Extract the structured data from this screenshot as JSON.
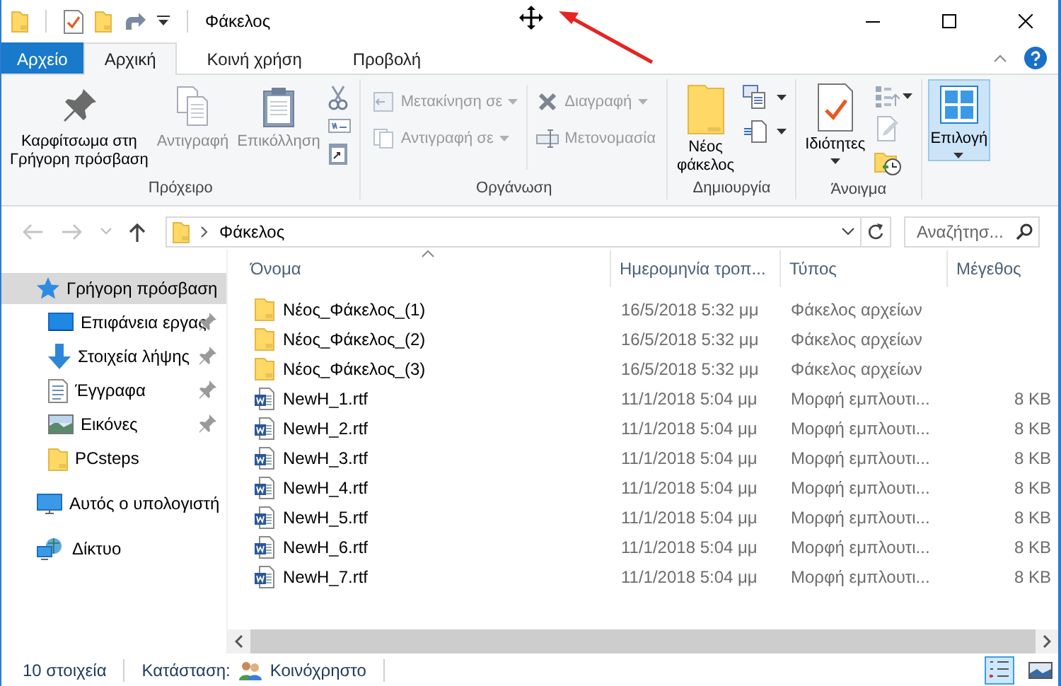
{
  "title_bar": {
    "title": "Φάκελος"
  },
  "ribbon": {
    "tabs": [
      {
        "label": "Αρχείο",
        "kind": "file",
        "selected": false
      },
      {
        "label": "Αρχική",
        "kind": "tab",
        "selected": true
      },
      {
        "label": "Κοινή χρήση",
        "kind": "tab",
        "selected": false
      },
      {
        "label": "Προβολή",
        "kind": "tab",
        "selected": false
      }
    ],
    "groups": [
      {
        "label": "Πρόχειρο",
        "buttons": [
          {
            "label": "Καρφίτσωμα στη\nΓρήγορη πρόσβαση",
            "disabled": false,
            "dropdown": false,
            "pressed": false
          },
          {
            "label": "Αντιγραφή",
            "disabled": true,
            "dropdown": false,
            "pressed": false
          },
          {
            "label": "Επικόλληση",
            "disabled": true,
            "dropdown": false,
            "pressed": false
          }
        ]
      },
      {
        "label": "Οργάνωση",
        "buttons": [
          {
            "label": "Μετακίνηση σε",
            "disabled": true,
            "dropdown": true,
            "pressed": false
          },
          {
            "label": "Αντιγραφή σε",
            "disabled": true,
            "dropdown": true,
            "pressed": false
          },
          {
            "label": "Διαγραφή",
            "disabled": true,
            "dropdown": true,
            "pressed": false
          },
          {
            "label": "Μετονομασία",
            "disabled": true,
            "dropdown": false,
            "pressed": false
          }
        ]
      },
      {
        "label": "Δημιουργία",
        "buttons": [
          {
            "label": "Νέος\nφάκελος",
            "disabled": false,
            "dropdown": false,
            "pressed": false
          }
        ]
      },
      {
        "label": "Άνοιγμα",
        "buttons": [
          {
            "label": "Ιδιότητες",
            "disabled": false,
            "dropdown": true,
            "pressed": false
          }
        ]
      },
      {
        "buttons": [
          {
            "label": "Επιλογή",
            "disabled": false,
            "dropdown": true,
            "pressed": true
          }
        ]
      }
    ]
  },
  "address": {
    "path": "Φάκελος",
    "search_placeholder": "Αναζήτησ..."
  },
  "navigation": [
    {
      "label": "Γρήγορη πρόσβαση",
      "selected": true,
      "children": [
        {
          "label": "Επιφάνεια εργας",
          "selected": false,
          "pinned": true
        },
        {
          "label": "Στοιχεία λήψης",
          "selected": false,
          "pinned": true
        },
        {
          "label": "Έγγραφα",
          "selected": false,
          "pinned": true
        },
        {
          "label": "Εικόνες",
          "selected": false,
          "pinned": true
        },
        {
          "label": "PCsteps",
          "selected": false,
          "pinned": false
        }
      ]
    },
    {
      "label": "Αυτός ο υπολογιστή",
      "selected": false
    },
    {
      "label": "Δίκτυο",
      "selected": false
    }
  ],
  "files": {
    "columns": [
      {
        "label": "Όνομα",
        "sorted": true
      },
      {
        "label": "Ημερομηνία τροπ...",
        "sorted": false
      },
      {
        "label": "Τύπος",
        "sorted": false
      },
      {
        "label": "Μέγεθος",
        "sorted": false
      }
    ],
    "rows": [
      {
        "kind": "folder",
        "name": "Νέος_Φάκελος_(1)",
        "modified": "16/5/2018 5:32 μμ",
        "type": "Φάκελος αρχείων"
      },
      {
        "kind": "folder",
        "name": "Νέος_Φάκελος_(2)",
        "modified": "16/5/2018 5:32 μμ",
        "type": "Φάκελος αρχείων"
      },
      {
        "kind": "folder",
        "name": "Νέος_Φάκελος_(3)",
        "modified": "16/5/2018 5:32 μμ",
        "type": "Φάκελος αρχείων"
      },
      {
        "kind": "document",
        "name": "NewH_1.rtf",
        "modified": "11/1/2018 5:04 μμ",
        "type": "Μορφή εμπλουτι...",
        "size": "8 KB"
      },
      {
        "kind": "document",
        "name": "NewH_2.rtf",
        "modified": "11/1/2018 5:04 μμ",
        "type": "Μορφή εμπλουτι...",
        "size": "8 KB"
      },
      {
        "kind": "document",
        "name": "NewH_3.rtf",
        "modified": "11/1/2018 5:04 μμ",
        "type": "Μορφή εμπλουτι...",
        "size": "8 KB"
      },
      {
        "kind": "document",
        "name": "NewH_4.rtf",
        "modified": "11/1/2018 5:04 μμ",
        "type": "Μορφή εμπλουτι...",
        "size": "8 KB"
      },
      {
        "kind": "document",
        "name": "NewH_5.rtf",
        "modified": "11/1/2018 5:04 μμ",
        "type": "Μορφή εμπλουτι...",
        "size": "8 KB"
      },
      {
        "kind": "document",
        "name": "NewH_6.rtf",
        "modified": "11/1/2018 5:04 μμ",
        "type": "Μορφή εμπλουτι...",
        "size": "8 KB"
      },
      {
        "kind": "document",
        "name": "NewH_7.rtf",
        "modified": "11/1/2018 5:04 μμ",
        "type": "Μορφή εμπλουτι...",
        "size": "8 KB"
      }
    ]
  },
  "status_bar": {
    "count": "10 στοιχεία",
    "state_label": "Κατάσταση:",
    "state": "Κοινόχρηστο",
    "views": [
      {
        "kind": "details",
        "selected": true
      },
      {
        "kind": "large_icons",
        "selected": false
      }
    ]
  }
}
